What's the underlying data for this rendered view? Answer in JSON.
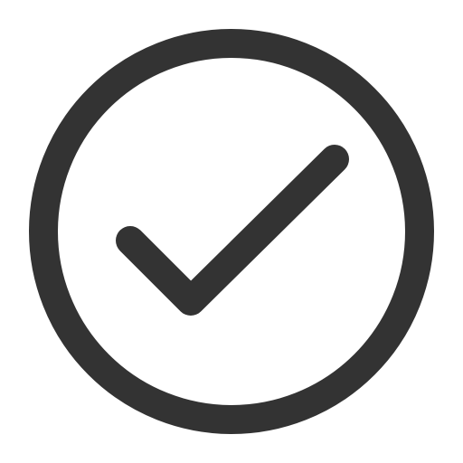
{
  "icon": {
    "name": "check-circle-icon",
    "stroke_color": "#333333",
    "background_color": "#ffffff"
  }
}
